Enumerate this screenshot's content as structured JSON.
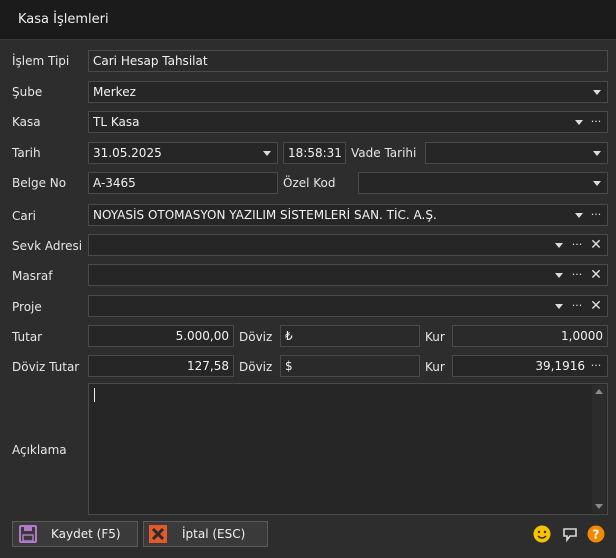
{
  "window": {
    "title": "Kasa İşlemleri"
  },
  "form": {
    "islem_tipi": {
      "label": "İşlem Tipi",
      "value": "Cari Hesap Tahsilat"
    },
    "sube": {
      "label": "Şube",
      "value": "Merkez"
    },
    "kasa": {
      "label": "Kasa",
      "value": "TL Kasa"
    },
    "tarih": {
      "label": "Tarih",
      "date": "31.05.2025",
      "time": "18:58:31"
    },
    "vade_tarihi": {
      "label": "Vade Tarihi",
      "value": ""
    },
    "belge_no": {
      "label": "Belge No",
      "value": "A-3465"
    },
    "ozel_kod": {
      "label": "Özel Kod",
      "value": ""
    },
    "cari": {
      "label": "Cari",
      "value": "NOYASİS OTOMASYON YAZILIM SİSTEMLERİ SAN. TİC. A.Ş."
    },
    "sevk_adresi": {
      "label": "Sevk Adresi",
      "value": ""
    },
    "masraf": {
      "label": "Masraf",
      "value": ""
    },
    "proje": {
      "label": "Proje",
      "value": ""
    },
    "tutar": {
      "label": "Tutar",
      "value": "5.000,00",
      "doviz_label": "Döviz",
      "doviz_value": "₺",
      "kur_label": "Kur",
      "kur_value": "1,0000"
    },
    "doviz_tutar": {
      "label": "Döviz Tutar",
      "value": "127,58",
      "doviz_label": "Döviz",
      "doviz_value": "$",
      "kur_label": "Kur",
      "kur_value": "39,1916"
    },
    "aciklama": {
      "label": "Açıklama",
      "value": ""
    }
  },
  "controls": {
    "dots": "···",
    "clear": "✕"
  },
  "buttons": {
    "save": "Kaydet (F5)",
    "cancel": "İptal (ESC)"
  },
  "status_icons": [
    "smiley-icon",
    "feedback-icon",
    "help-icon"
  ],
  "help_glyph": "?",
  "colors": {
    "smiley": "#f5c400",
    "help": "#f08a00",
    "cancel_icon": "#e05a2a",
    "save_icon": "#b07ac8"
  }
}
